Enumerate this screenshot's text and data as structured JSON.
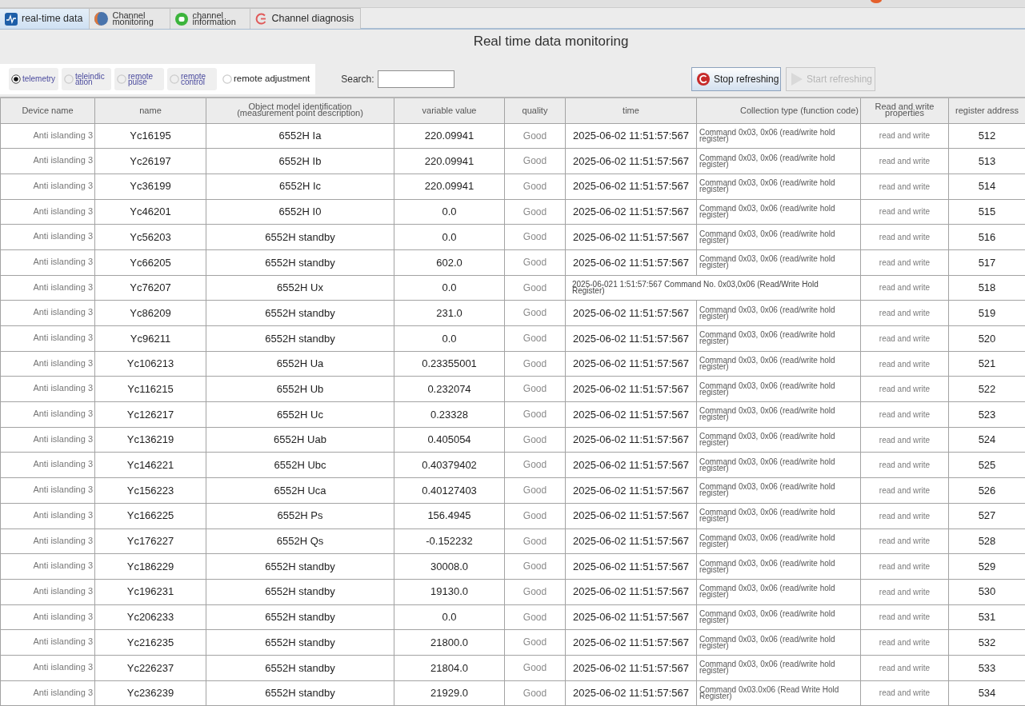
{
  "tabs": [
    {
      "label": "real-time data",
      "selected": true
    },
    {
      "label": "Channel monitoring",
      "selected": false
    },
    {
      "label": "channel information",
      "selected": false
    },
    {
      "label": "Channel diagnosis",
      "selected": false
    }
  ],
  "title": "Real time data monitoring",
  "point_types": [
    {
      "label": "telemetry",
      "selected": true
    },
    {
      "label": "teleindication",
      "selected": false
    },
    {
      "label": "remote pulse",
      "selected": false
    },
    {
      "label": "remote control",
      "selected": false
    },
    {
      "label": "remote adjustment",
      "selected": false
    }
  ],
  "search": {
    "label": "Search:"
  },
  "buttons": [
    {
      "label": "Stop refreshing",
      "disabled": false
    },
    {
      "label": "Start refreshing",
      "disabled": true
    }
  ],
  "table": {
    "columns": [
      "Device name",
      "name",
      "Object model identification (measurement point description)",
      "variable value",
      "quality",
      "time",
      "Collection type (function code)",
      "Read and write properties",
      "register address"
    ],
    "rows": [
      {
        "kind": "normal",
        "device_name": "Anti islanding 3",
        "name": "Yc16195",
        "object_model": "6552H Ia",
        "variable_value": "220.09941",
        "quality": "Good",
        "time": "2025-06-02 11:51:57:567",
        "collection_type": "Command 0x03, 0x06 (read/write hold register)",
        "read_write": "read and write",
        "register_address": "512"
      },
      {
        "kind": "normal",
        "device_name": "Anti islanding 3",
        "name": "Yc26197",
        "object_model": "6552H Ib",
        "variable_value": "220.09941",
        "quality": "Good",
        "time": "2025-06-02 11:51:57:567",
        "collection_type": "Command 0x03, 0x06 (read/write hold register)",
        "read_write": "read and write",
        "register_address": "513"
      },
      {
        "kind": "normal",
        "device_name": "Anti islanding 3",
        "name": "Yc36199",
        "object_model": "6552H Ic",
        "variable_value": "220.09941",
        "quality": "Good",
        "time": "2025-06-02 11:51:57:567",
        "collection_type": "Command 0x03, 0x06 (read/write hold register)",
        "read_write": "read and write",
        "register_address": "514"
      },
      {
        "kind": "normal",
        "device_name": "Anti islanding 3",
        "name": "Yc46201",
        "object_model": "6552H I0",
        "variable_value": "0.0",
        "quality": "Good",
        "time": "2025-06-02 11:51:57:567",
        "collection_type": "Command 0x03, 0x06 (read/write hold register)",
        "read_write": "read and write",
        "register_address": "515"
      },
      {
        "kind": "normal",
        "device_name": "Anti islanding 3",
        "name": "Yc56203",
        "object_model": "6552H standby",
        "variable_value": "0.0",
        "quality": "Good",
        "time": "2025-06-02 11:51:57:567",
        "collection_type": "Command 0x03, 0x06 (read/write hold register)",
        "read_write": "read and write",
        "register_address": "516"
      },
      {
        "kind": "normal",
        "device_name": "Anti islanding 3",
        "name": "Yc66205",
        "object_model": "6552H standby",
        "variable_value": "602.0",
        "quality": "Good",
        "time": "2025-06-02 11:51:57:567",
        "collection_type": "Command 0x03, 0x06 (read/write hold register)",
        "read_write": "read and write",
        "register_address": "517"
      },
      {
        "kind": "merged",
        "device_name": "Anti islanding 3",
        "name": "Yc76207",
        "object_model": "6552H Ux",
        "variable_value": "0.0",
        "quality": "Good",
        "time_and_collection": "2025-06-021 1:51:57:567 Command No. 0x03,0x06 (Read/Write Hold Register)",
        "read_write": "read and write",
        "register_address": "518"
      },
      {
        "kind": "normal",
        "device_name": "Anti islanding 3",
        "name": "Yc86209",
        "object_model": "6552H standby",
        "variable_value": "231.0",
        "quality": "Good",
        "time": "2025-06-02 11:51:57:567",
        "collection_type": "Command 0x03, 0x06 (read/write hold register)",
        "read_write": "read and write",
        "register_address": "519"
      },
      {
        "kind": "normal",
        "device_name": "Anti islanding 3",
        "name": "Yc96211",
        "object_model": "6552H standby",
        "variable_value": "0.0",
        "quality": "Good",
        "time": "2025-06-02 11:51:57:567",
        "collection_type": "Command 0x03, 0x06 (read/write hold register)",
        "read_write": "read and write",
        "register_address": "520"
      },
      {
        "kind": "normal",
        "device_name": "Anti islanding 3",
        "name": "Yc106213",
        "object_model": "6552H Ua",
        "variable_value": "0.23355001",
        "quality": "Good",
        "time": "2025-06-02 11:51:57:567",
        "collection_type": "Command 0x03, 0x06 (read/write hold register)",
        "read_write": "read and write",
        "register_address": "521"
      },
      {
        "kind": "normal",
        "device_name": "Anti islanding 3",
        "name": "Yc116215",
        "object_model": "6552H Ub",
        "variable_value": "0.232074",
        "quality": "Good",
        "time": "2025-06-02 11:51:57:567",
        "collection_type": "Command 0x03, 0x06 (read/write hold register)",
        "read_write": "read and write",
        "register_address": "522"
      },
      {
        "kind": "normal",
        "device_name": "Anti islanding 3",
        "name": "Yc126217",
        "object_model": "6552H Uc",
        "variable_value": "0.23328",
        "quality": "Good",
        "time": "2025-06-02 11:51:57:567",
        "collection_type": "Command 0x03, 0x06 (read/write hold register)",
        "read_write": "read and write",
        "register_address": "523"
      },
      {
        "kind": "normal",
        "device_name": "Anti islanding 3",
        "name": "Yc136219",
        "object_model": "6552H Uab",
        "variable_value": "0.405054",
        "quality": "Good",
        "time": "2025-06-02 11:51:57:567",
        "collection_type": "Command 0x03, 0x06 (read/write hold register)",
        "read_write": "read and write",
        "register_address": "524"
      },
      {
        "kind": "normal",
        "device_name": "Anti islanding 3",
        "name": "Yc146221",
        "object_model": "6552H Ubc",
        "variable_value": "0.40379402",
        "quality": "Good",
        "time": "2025-06-02 11:51:57:567",
        "collection_type": "Command 0x03, 0x06 (read/write hold register)",
        "read_write": "read and write",
        "register_address": "525"
      },
      {
        "kind": "normal",
        "device_name": "Anti islanding 3",
        "name": "Yc156223",
        "object_model": "6552H Uca",
        "variable_value": "0.40127403",
        "quality": "Good",
        "time": "2025-06-02 11:51:57:567",
        "collection_type": "Command 0x03, 0x06 (read/write hold register)",
        "read_write": "read and write",
        "register_address": "526"
      },
      {
        "kind": "normal",
        "device_name": "Anti islanding 3",
        "name": "Yc166225",
        "object_model": "6552H Ps",
        "variable_value": "156.4945",
        "quality": "Good",
        "time": "2025-06-02 11:51:57:567",
        "collection_type": "Command 0x03, 0x06 (read/write hold register)",
        "read_write": "read and write",
        "register_address": "527"
      },
      {
        "kind": "normal",
        "device_name": "Anti islanding 3",
        "name": "Yc176227",
        "object_model": "6552H Qs",
        "variable_value": "-0.152232",
        "quality": "Good",
        "time": "2025-06-02 11:51:57:567",
        "collection_type": "Command 0x03, 0x06 (read/write hold register)",
        "read_write": "read and write",
        "register_address": "528"
      },
      {
        "kind": "normal",
        "device_name": "Anti islanding 3",
        "name": "Yc186229",
        "object_model": "6552H standby",
        "variable_value": "30008.0",
        "quality": "Good",
        "time": "2025-06-02 11:51:57:567",
        "collection_type": "Command 0x03, 0x06 (read/write hold register)",
        "read_write": "read and write",
        "register_address": "529"
      },
      {
        "kind": "normal",
        "device_name": "Anti islanding 3",
        "name": "Yc196231",
        "object_model": "6552H standby",
        "variable_value": "19130.0",
        "quality": "Good",
        "time": "2025-06-02 11:51:57:567",
        "collection_type": "Command 0x03, 0x06 (read/write hold register)",
        "read_write": "read and write",
        "register_address": "530"
      },
      {
        "kind": "normal",
        "device_name": "Anti islanding 3",
        "name": "Yc206233",
        "object_model": "6552H standby",
        "variable_value": "0.0",
        "quality": "Good",
        "time": "2025-06-02 11:51:57:567",
        "collection_type": "Command 0x03, 0x06 (read/write hold register)",
        "read_write": "read and write",
        "register_address": "531"
      },
      {
        "kind": "normal",
        "device_name": "Anti islanding 3",
        "name": "Yc216235",
        "object_model": "6552H standby",
        "variable_value": "21800.0",
        "quality": "Good",
        "time": "2025-06-02 11:51:57:567",
        "collection_type": "Command 0x03, 0x06 (read/write hold register)",
        "read_write": "read and write",
        "register_address": "532"
      },
      {
        "kind": "normal",
        "device_name": "Anti islanding 3",
        "name": "Yc226237",
        "object_model": "6552H standby",
        "variable_value": "21804.0",
        "quality": "Good",
        "time": "2025-06-02 11:51:57:567",
        "collection_type": "Command 0x03, 0x06 (read/write hold register)",
        "read_write": "read and write",
        "register_address": "533"
      },
      {
        "kind": "normal",
        "device_name": "Anti islanding 3",
        "name": "Yc236239",
        "object_model": "6552H standby",
        "variable_value": "21929.0",
        "quality": "Good",
        "time": "2025-06-02 11:51:57:567",
        "collection_type": "Command 0x03.0x06 (Read Write Hold Register)",
        "read_write": "read and write",
        "register_address": "534"
      }
    ]
  }
}
